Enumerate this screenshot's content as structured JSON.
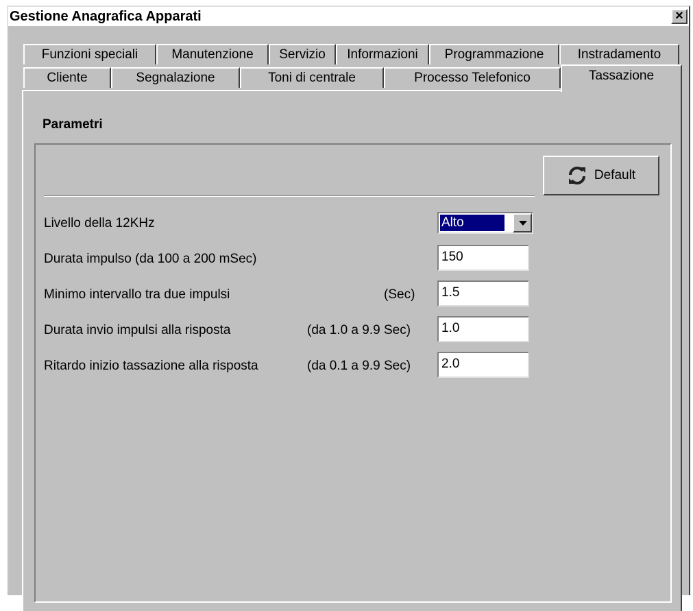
{
  "window": {
    "title": "Gestione Anagrafica Apparati",
    "close_label": "×"
  },
  "tabs_row1": [
    {
      "label": "Funzioni speciali"
    },
    {
      "label": "Manutenzione"
    },
    {
      "label": "Servizio"
    },
    {
      "label": "Informazioni"
    },
    {
      "label": "Programmazione"
    },
    {
      "label": "Instradamento"
    }
  ],
  "tabs_row2": [
    {
      "label": "Cliente"
    },
    {
      "label": "Segnalazione"
    },
    {
      "label": "Toni di centrale"
    },
    {
      "label": "Processo Telefonico"
    },
    {
      "label": "Tassazione",
      "active": true
    }
  ],
  "panel": {
    "section_title": "Parametri",
    "default_button": {
      "label": "Default",
      "icon": "refresh-icon"
    }
  },
  "fields": {
    "livello": {
      "label": "Livello della 12KHz",
      "value": "Alto"
    },
    "durata_impulso": {
      "label": "Durata impulso   (da 100 a 200 mSec)",
      "value": "150"
    },
    "minimo_intervallo": {
      "label": "Minimo intervallo tra due impulsi",
      "suffix": "(Sec)",
      "value": "1.5"
    },
    "durata_invio": {
      "label": "Durata invio impulsi alla risposta",
      "suffix": "(da 1.0 a 9.9 Sec)",
      "value": "1.0"
    },
    "ritardo": {
      "label": "Ritardo inizio tassazione alla risposta",
      "suffix": "(da 0.1 a 9.9 Sec)",
      "value": "2.0"
    }
  },
  "colors": {
    "face": "#c0c0c0",
    "selection": "#000080",
    "field": "#ffffff"
  }
}
